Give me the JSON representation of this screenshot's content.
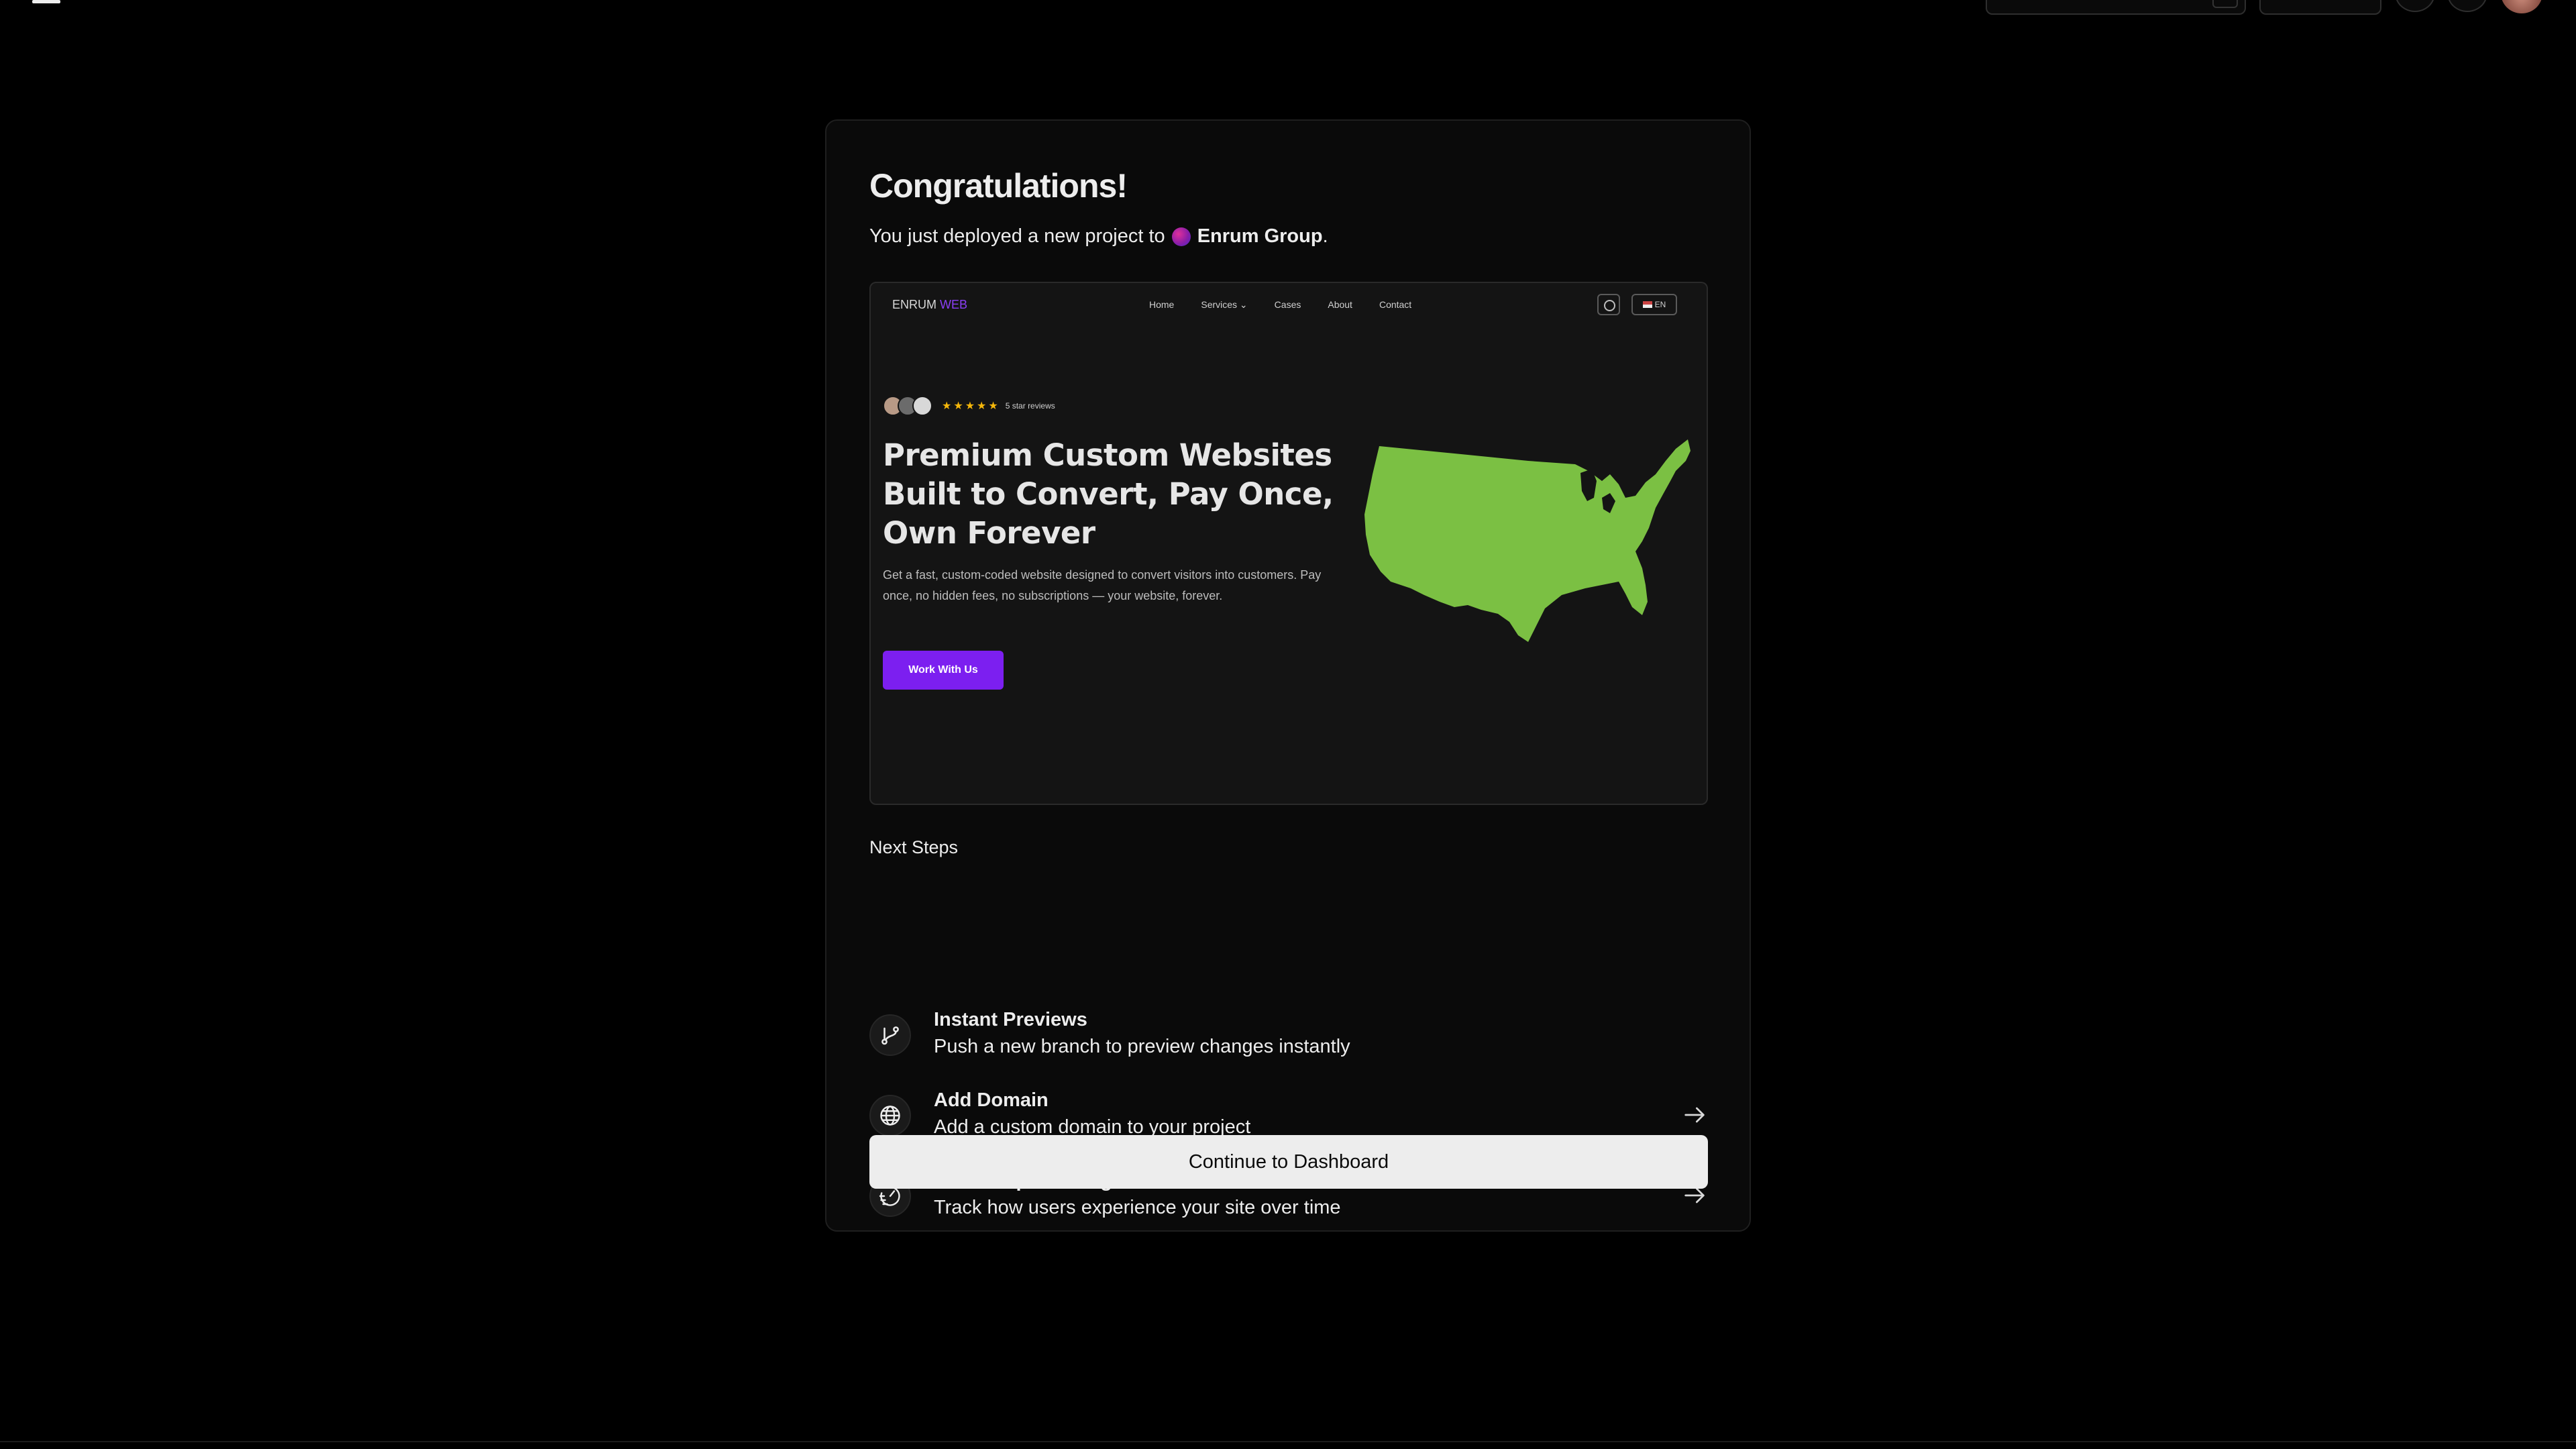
{
  "topbar": {
    "menu_icon": "hamburger-menu-icon"
  },
  "card": {
    "title": "Congratulations!",
    "subtitle_prefix": "You just deployed a new project to",
    "team_name": "Enrum Group",
    "subtitle_suffix": "."
  },
  "preview": {
    "logo_main": "ENRUM",
    "logo_accent": "WEB",
    "nav": [
      "Home",
      "Services ⌄",
      "Cases",
      "About",
      "Contact"
    ],
    "lang_label": "EN",
    "rating_stars": "★★★★★",
    "reviews_text": "5 star reviews",
    "headline": "Premium Custom Websites Built to Convert, Pay Once, Own Forever",
    "description": "Get a fast, custom-coded website designed to convert visitors into customers. Pay once, no hidden fees, no subscriptions — your website, forever.",
    "cta_label": "Work With Us",
    "map_color": "#7bc043",
    "cta_color": "#7c1ff0"
  },
  "next_steps": {
    "title": "Next Steps",
    "items": [
      {
        "title": "Instant Previews",
        "description": "Push a new branch to preview changes instantly",
        "icon": "git-branch-icon"
      },
      {
        "title": "Add Domain",
        "description": "Add a custom domain to your project",
        "icon": "globe-icon"
      },
      {
        "title": "Enable Speed Insights",
        "description": "Track how users experience your site over time",
        "icon": "speed-gauge-icon"
      }
    ]
  },
  "continue_label": "Continue to Dashboard"
}
